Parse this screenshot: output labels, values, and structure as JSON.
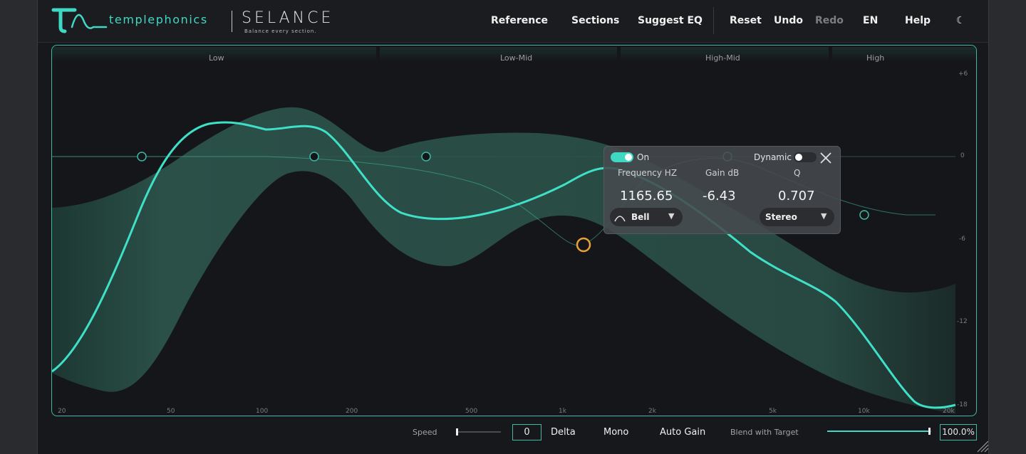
{
  "header": {
    "brand": "templephonics",
    "product": "SELANCE",
    "tagline": "Balance every section.",
    "nav": {
      "reference": "Reference",
      "sections": "Sections",
      "suggest_eq": "Suggest EQ",
      "reset": "Reset",
      "undo": "Undo",
      "redo": "Redo",
      "language": "EN",
      "help": "Help",
      "theme": "☾"
    }
  },
  "graph": {
    "sections": [
      "Low",
      "Low-Mid",
      "High-Mid",
      "High"
    ],
    "freq_ticks": [
      "20",
      "50",
      "100",
      "200",
      "500",
      "1k",
      "2k",
      "5k",
      "10k",
      "20k"
    ],
    "db_ticks": [
      "+6",
      "0",
      "-6",
      "-12",
      "-18"
    ],
    "colors": {
      "curve": "#3fe0c8",
      "band": "#2e5a50",
      "selected_node": "#e8a23a",
      "node": "#3fb9a6"
    }
  },
  "band_popup": {
    "on_label": "On",
    "on_state": true,
    "dynamic_label": "Dynamic",
    "dynamic_state": false,
    "frequency_label": "Frequency HZ",
    "gain_label": "Gain dB",
    "q_label": "Q",
    "frequency": "1165.65",
    "gain": "-6.43",
    "q": "0.707",
    "shape": "Bell",
    "channel": "Stereo",
    "close_icon": "close-icon"
  },
  "footer": {
    "speed_label": "Speed",
    "speed_value": "0",
    "delta": "Delta",
    "mono": "Mono",
    "auto_gain": "Auto Gain",
    "blend_label": "Blend with Target",
    "blend_value": "100.0%",
    "blend_fraction": 1.0
  }
}
